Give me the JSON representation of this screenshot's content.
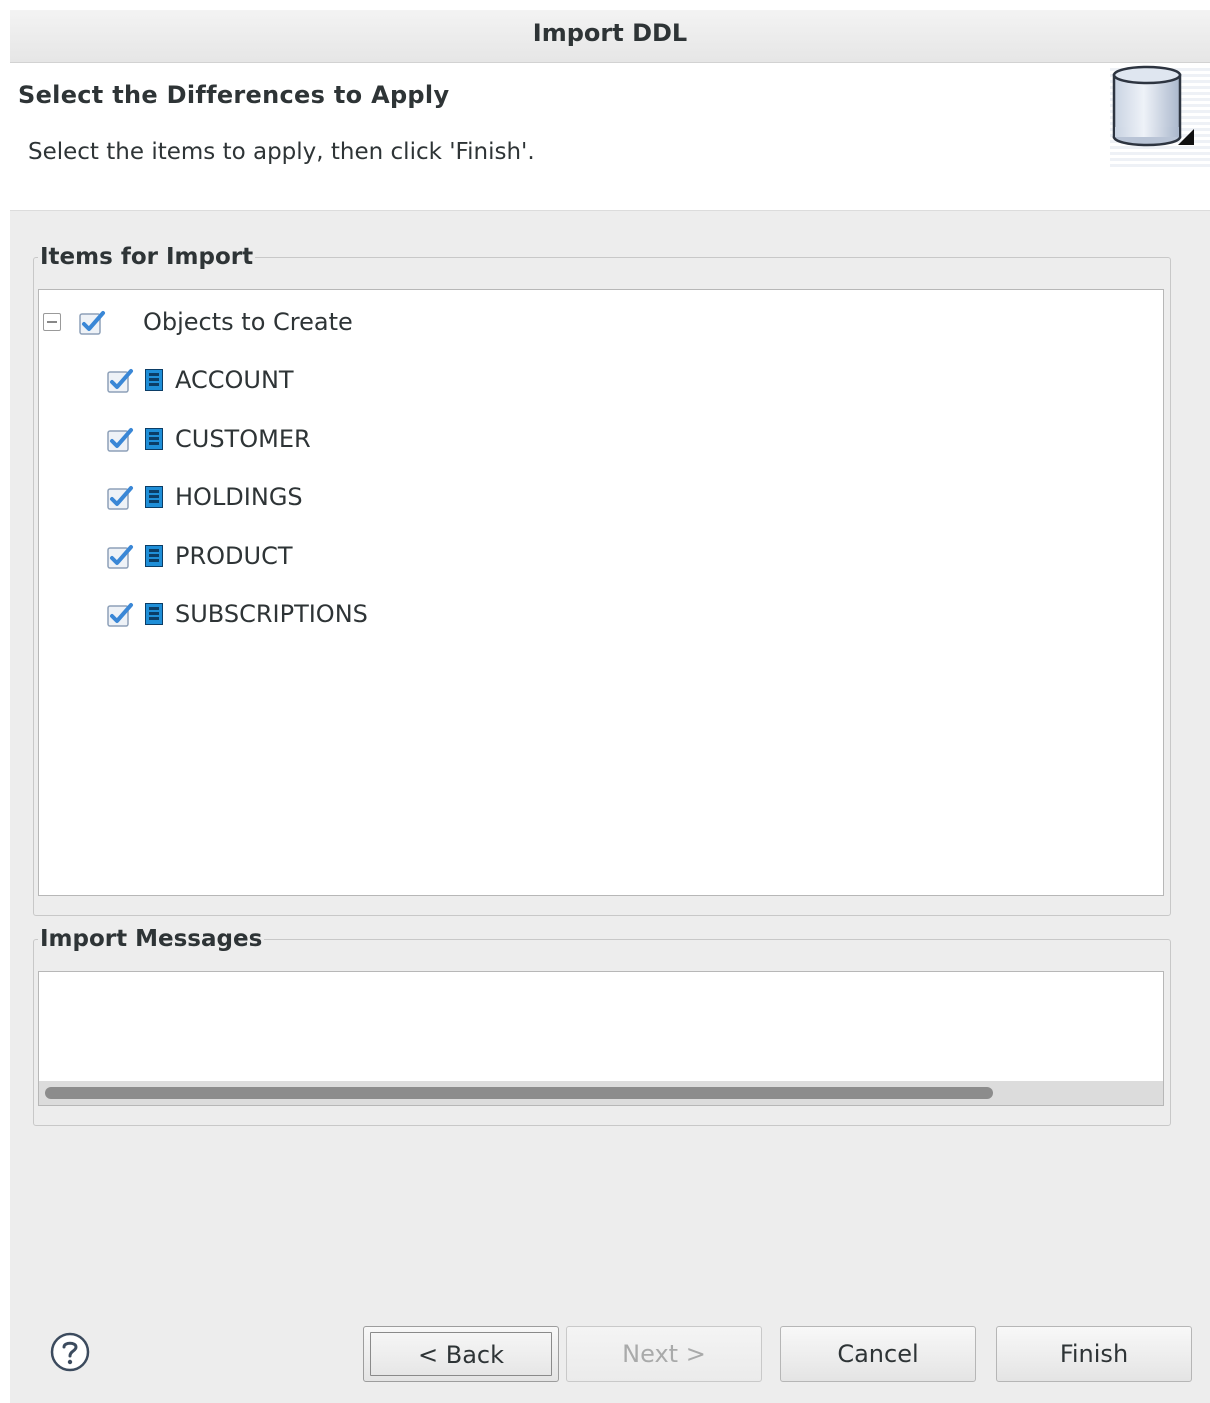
{
  "window": {
    "title": "Import DDL"
  },
  "banner": {
    "title": "Select the Differences to Apply",
    "description": "Select the items to apply, then click 'Finish'."
  },
  "items_group": {
    "legend": "Items for Import",
    "tree": {
      "root": {
        "label": "Objects to Create",
        "checked": true,
        "expanded": true
      },
      "children": [
        {
          "label": "ACCOUNT",
          "checked": true,
          "icon": "table-icon"
        },
        {
          "label": "CUSTOMER",
          "checked": true,
          "icon": "table-icon"
        },
        {
          "label": "HOLDINGS",
          "checked": true,
          "icon": "table-icon"
        },
        {
          "label": "PRODUCT",
          "checked": true,
          "icon": "table-icon"
        },
        {
          "label": "SUBSCRIPTIONS",
          "checked": true,
          "icon": "table-icon"
        }
      ]
    }
  },
  "messages_group": {
    "legend": "Import Messages"
  },
  "buttons": {
    "back": "< Back",
    "next": "Next >",
    "cancel": "Cancel",
    "finish": "Finish"
  },
  "colors": {
    "accent": "#3a87d6",
    "table_icon": "#1f8fd8"
  }
}
